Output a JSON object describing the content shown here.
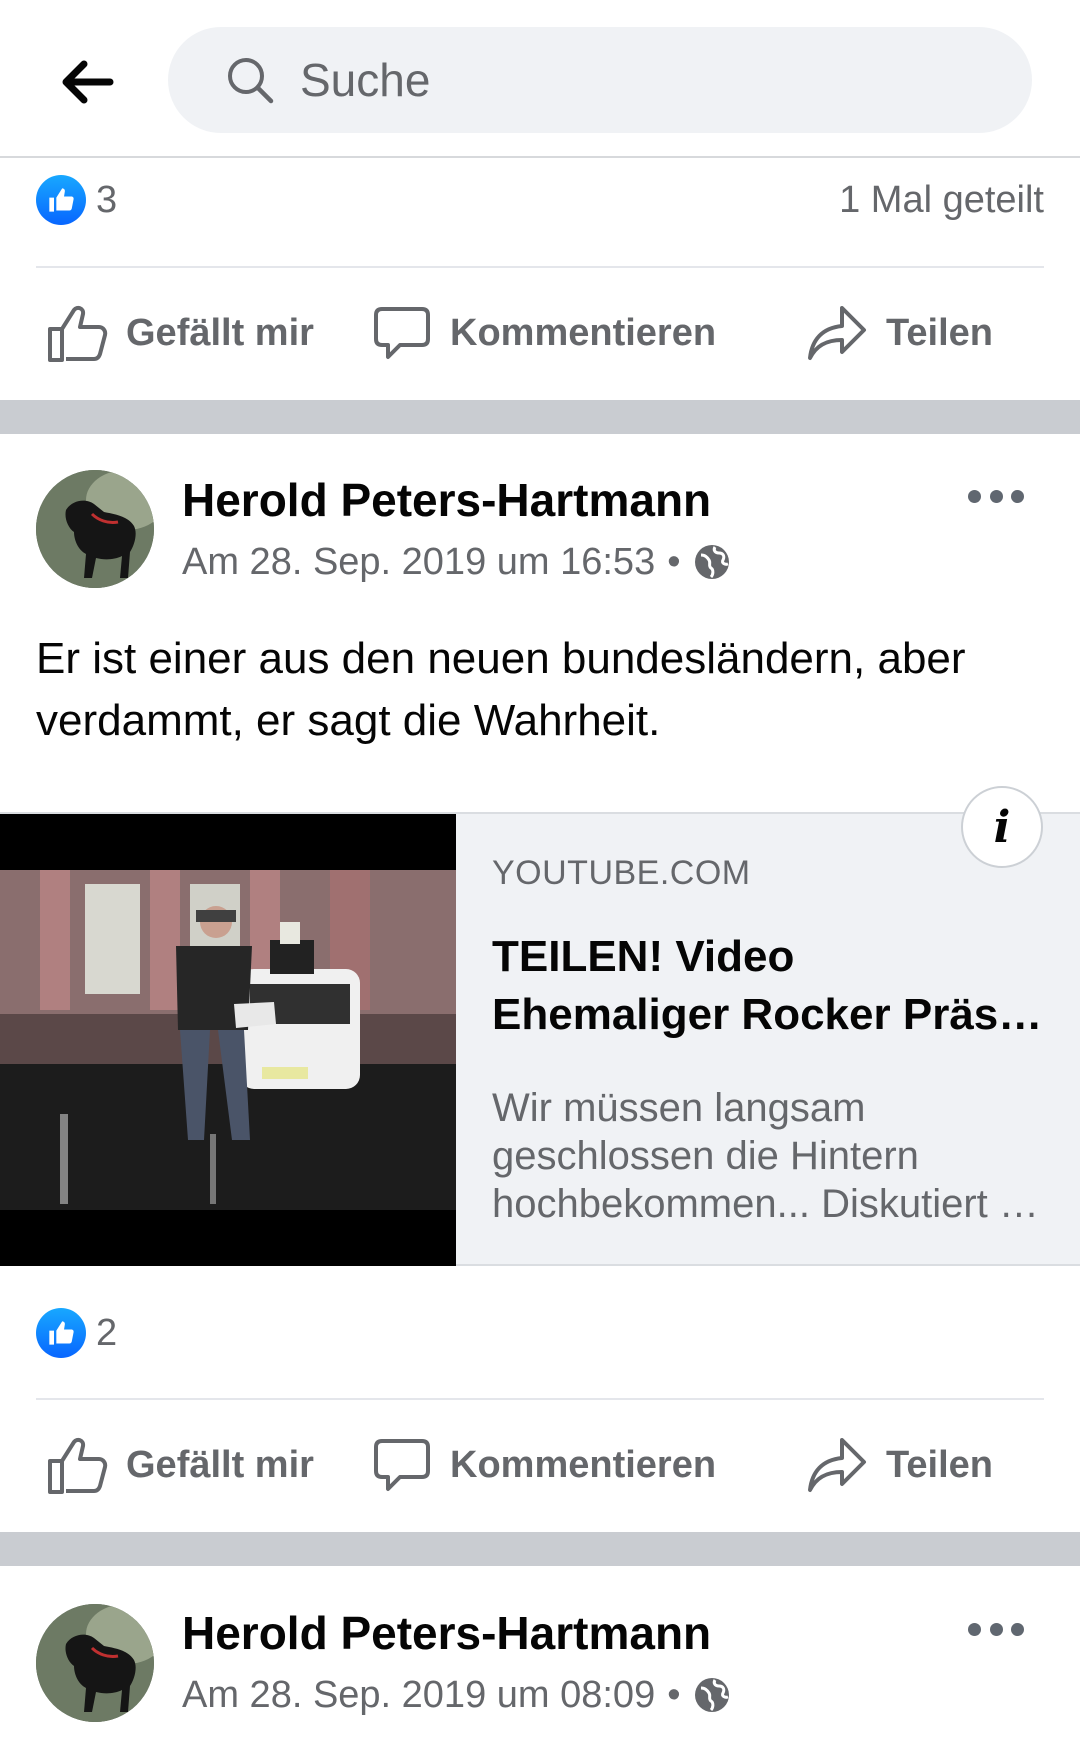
{
  "search": {
    "placeholder": "Suche"
  },
  "post0": {
    "reaction_count": "3",
    "shares": "1 Mal geteilt"
  },
  "actions": {
    "like": "Gefällt mir",
    "comment": "Kommentieren",
    "share": "Teilen"
  },
  "post1": {
    "author": "Herold Peters-Hartmann",
    "timestamp": "Am 28. Sep. 2019 um 16:53",
    "separator": "•",
    "text": "Er ist einer aus den neuen bundesländern, aber verdammt, er sagt die Wahrheit.",
    "link": {
      "domain": "YOUTUBE.COM",
      "title_line1": "TEILEN! Video",
      "title_line2": "Ehemaliger Rocker Präsentiert",
      "desc_line1": "Wir müssen langsam",
      "desc_line2": "geschlossen die Hintern",
      "desc_line3": "hochbekommen... Diskutiert mit"
    },
    "reaction_count": "2"
  },
  "post2": {
    "author": "Herold Peters-Hartmann",
    "timestamp": "Am 28. Sep. 2019 um 08:09",
    "separator": "•"
  },
  "colors": {
    "accent": "#1877f2",
    "text_secondary": "#65676b",
    "background_gap": "#c9ccd1"
  },
  "icons": [
    "back-arrow-icon",
    "search-icon",
    "like-reaction-icon",
    "thumbs-up-icon",
    "comment-icon",
    "share-arrow-icon",
    "globe-icon",
    "more-dots-icon",
    "info-icon"
  ]
}
